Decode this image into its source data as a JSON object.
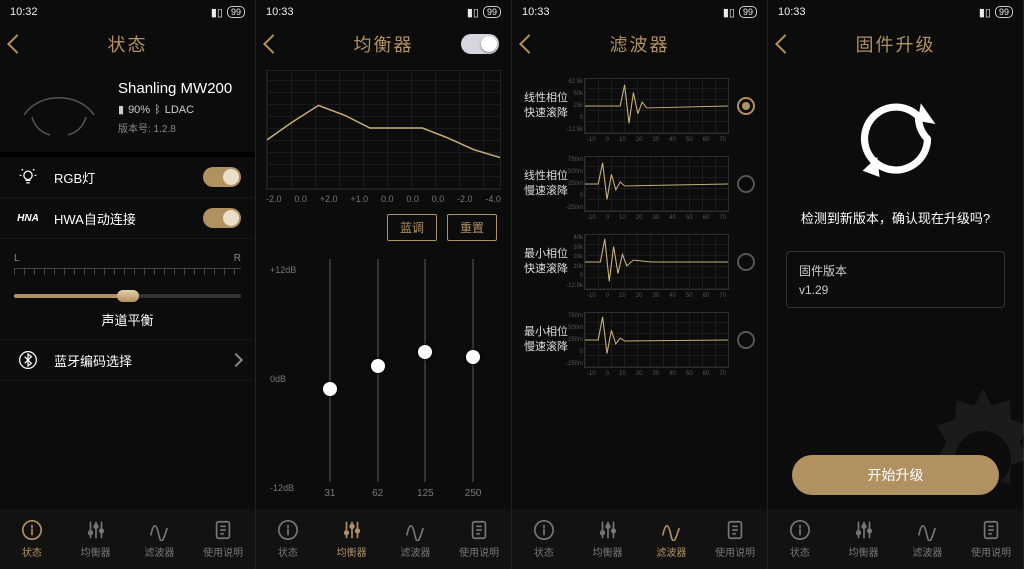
{
  "statusbar": {
    "time1": "10:32",
    "time2": "10:33",
    "battery": "99"
  },
  "colors": {
    "accent": "#b19162",
    "bg": "#0c0c0c"
  },
  "nav": {
    "items": [
      {
        "key": "status",
        "label": "状态"
      },
      {
        "key": "eq",
        "label": "均衡器"
      },
      {
        "key": "filter",
        "label": "滤波器"
      },
      {
        "key": "manual",
        "label": "使用说明"
      }
    ]
  },
  "screen1": {
    "title": "状态",
    "device": {
      "name": "Shanling MW200",
      "battery_pct": "90%",
      "codec": "LDAC",
      "fw_prefix": "版本号:",
      "fw": "1.2.8"
    },
    "rows": {
      "rgb": {
        "label": "RGB灯",
        "on": true
      },
      "hwa": {
        "prefix": "HNA",
        "label": "HWA自动连接",
        "on": true
      },
      "codec": {
        "label": "蓝牙编码选择"
      }
    },
    "balance": {
      "left": "L",
      "right": "R",
      "caption": "声道平衡",
      "position": 0.5
    }
  },
  "screen2": {
    "title": "均衡器",
    "toggle_on": true,
    "xlabels": [
      "-2.0",
      "0.0",
      "+2.0",
      "+1.0",
      "0.0",
      "0.0",
      "0.0",
      "-2.0",
      "-4.0"
    ],
    "buttons": {
      "preset": "蓝调",
      "reset": "重置"
    },
    "ylabels": {
      "top": "+12dB",
      "mid": "0dB",
      "bot": "-12dB"
    },
    "sliders": [
      {
        "freq": "31",
        "value": -2
      },
      {
        "freq": "62",
        "value": 0.5
      },
      {
        "freq": "125",
        "value": 2
      },
      {
        "freq": "250",
        "value": 1.5
      }
    ],
    "range": 12
  },
  "screen3": {
    "title": "滤波器",
    "xticks": [
      "-10",
      "0",
      "10",
      "20",
      "30",
      "40",
      "50",
      "60",
      "70"
    ],
    "filters": [
      {
        "name_l1": "线性相位",
        "name_l2": "快速滚降",
        "selected": true,
        "yticks": [
          "62.5k",
          "50k",
          "25k",
          "0",
          "-12.5k"
        ]
      },
      {
        "name_l1": "线性相位",
        "name_l2": "慢速滚降",
        "selected": false,
        "yticks": [
          "750m",
          "500m",
          "250m",
          "0",
          "-250m"
        ]
      },
      {
        "name_l1": "最小相位",
        "name_l2": "快速滚降",
        "selected": false,
        "yticks": [
          "40k",
          "30k",
          "20k",
          "10k",
          "0",
          "-12.5k"
        ]
      },
      {
        "name_l1": "最小相位",
        "name_l2": "慢速滚降",
        "selected": false,
        "yticks": [
          "750m",
          "500m",
          "250m",
          "0",
          "-250m"
        ]
      }
    ]
  },
  "screen4": {
    "title": "固件升级",
    "prompt": "检测到新版本，确认现在升级吗?",
    "box_title": "固件版本",
    "box_version": "v1.29",
    "cta": "开始升级"
  }
}
